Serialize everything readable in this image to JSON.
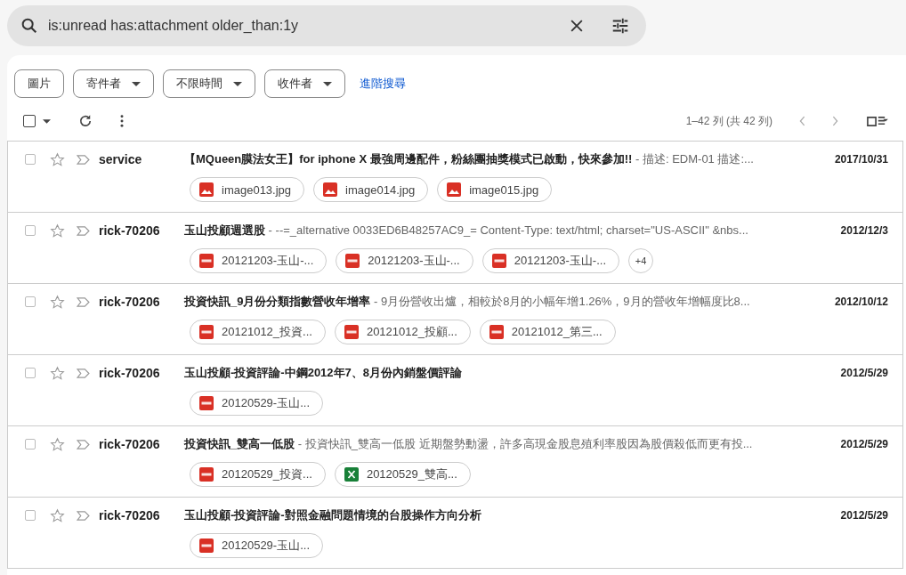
{
  "search": {
    "value": "is:unread has:attachment older_than:1y"
  },
  "filters": [
    {
      "label": "圖片",
      "dropdown": false
    },
    {
      "label": "寄件者",
      "dropdown": true
    },
    {
      "label": "不限時間",
      "dropdown": true
    },
    {
      "label": "收件者",
      "dropdown": true
    }
  ],
  "advanced_link": "進階搜尋",
  "select_all_checked": false,
  "pagination": "1–42 列 (共 42 列)",
  "emails": [
    {
      "sender": "service",
      "subject": "【MQueen膜法女王】for iphone X 最強周邊配件，粉絲團抽獎模式已啟動，快來參加!!",
      "snippet": " - 描述: EDM-01 描述:...",
      "date": "2017/10/31",
      "starred": false,
      "checked": false,
      "attachments": [
        {
          "kind": "image",
          "name": "image013.jpg"
        },
        {
          "kind": "image",
          "name": "image014.jpg"
        },
        {
          "kind": "image",
          "name": "image015.jpg"
        }
      ]
    },
    {
      "sender": "rick-70206",
      "subject": "玉山投顧週選股",
      "snippet": " - --=_alternative 0033ED6B48257AC9_= Content-Type: text/html; charset=\"US-ASCII\" &nbs...",
      "date": "2012/12/3",
      "starred": false,
      "checked": false,
      "attachments": [
        {
          "kind": "pdf",
          "name": "20121203-玉山-..."
        },
        {
          "kind": "pdf",
          "name": "20121203-玉山-..."
        },
        {
          "kind": "pdf",
          "name": "20121203-玉山-..."
        }
      ],
      "more": "+4"
    },
    {
      "sender": "rick-70206",
      "subject": "投資快訊_9月份分類指數營收年增率",
      "snippet": " - 9月份營收出爐，相較於8月的小幅年增1.26%，9月的營收年增幅度比8...",
      "date": "2012/10/12",
      "starred": false,
      "checked": false,
      "attachments": [
        {
          "kind": "pdf",
          "name": "20121012_投資..."
        },
        {
          "kind": "pdf",
          "name": "20121012_投顧..."
        },
        {
          "kind": "pdf",
          "name": "20121012_第三..."
        }
      ]
    },
    {
      "sender": "rick-70206",
      "subject": "玉山投顧-投資評論-中鋼2012年7、8月份內銷盤價評論",
      "date": "2012/5/29",
      "starred": false,
      "checked": false,
      "attachments": [
        {
          "kind": "pdf",
          "name": "20120529-玉山..."
        }
      ]
    },
    {
      "sender": "rick-70206",
      "subject": "投資快訊_雙高一低股",
      "snippet": " - 投資快訊_雙高一低股 近期盤勢動盪，許多高現金股息殖利率股因為股價殺低而更有投...",
      "date": "2012/5/29",
      "starred": false,
      "checked": false,
      "attachments": [
        {
          "kind": "pdf",
          "name": "20120529_投資..."
        },
        {
          "kind": "sheet",
          "name": "20120529_雙高..."
        }
      ]
    },
    {
      "sender": "rick-70206",
      "subject": "玉山投顧-投資評論-對照金融問題情境的台股操作方向分析",
      "date": "2012/5/29",
      "starred": false,
      "checked": false,
      "attachments": [
        {
          "kind": "pdf",
          "name": "20120529-玉山..."
        }
      ]
    }
  ]
}
